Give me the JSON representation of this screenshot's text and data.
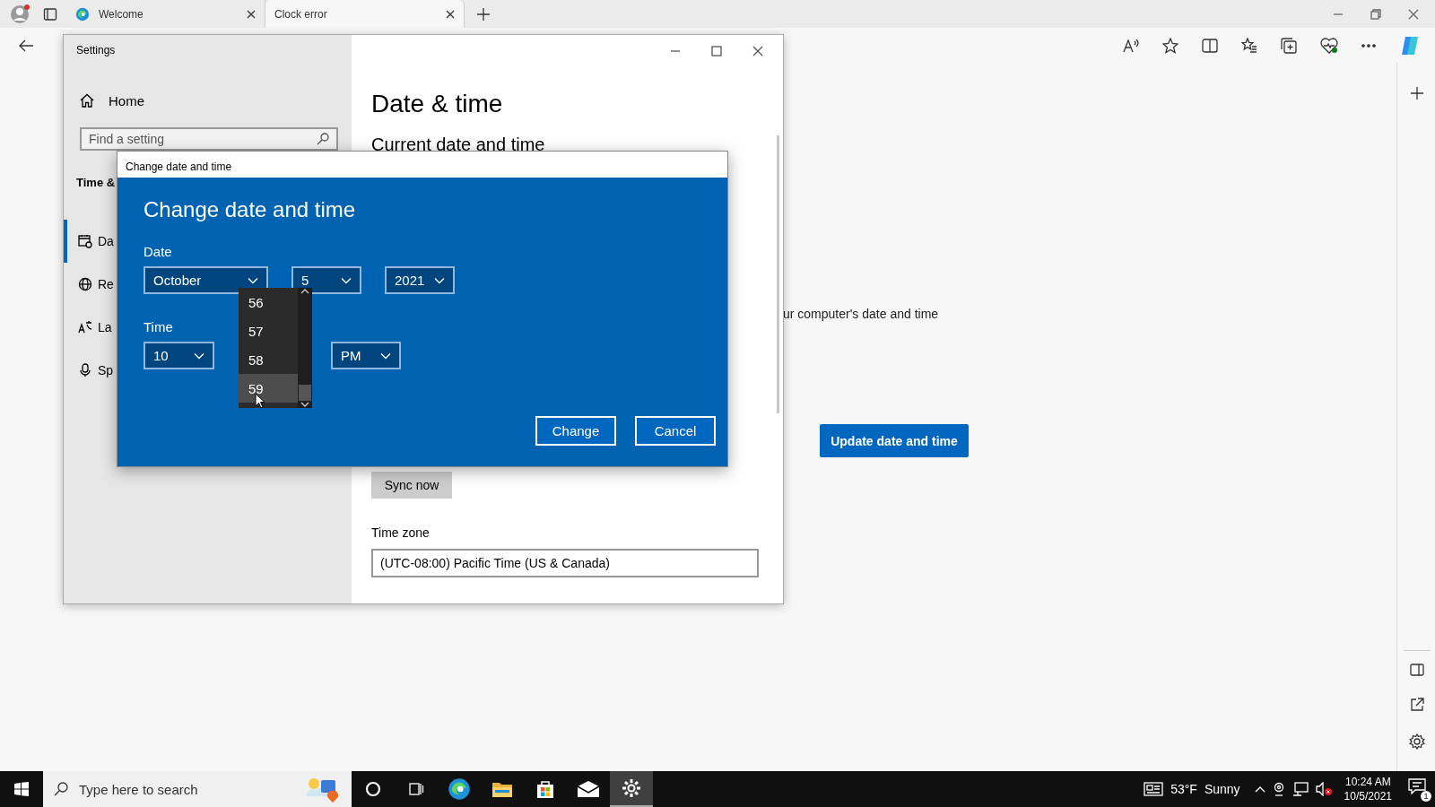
{
  "browser": {
    "tabs": [
      {
        "title": "Welcome",
        "kind": "edge",
        "selected": false
      },
      {
        "title": "Clock error",
        "kind": "page",
        "selected": true
      }
    ]
  },
  "page": {
    "partial_text": "ur computer's date and time",
    "update_button": "Update date and time"
  },
  "settings": {
    "title": "Settings",
    "home": "Home",
    "search_placeholder": "Find a setting",
    "section": "Time &",
    "nav": [
      {
        "label": "Da",
        "kind": "calendar",
        "selected": true
      },
      {
        "label": "Re",
        "kind": "globe",
        "selected": false
      },
      {
        "label": "La",
        "kind": "language",
        "selected": false
      },
      {
        "label": "Sp",
        "kind": "microphone",
        "selected": false
      }
    ],
    "heading": "Date & time",
    "subheading": "Current date and time",
    "sync_button": "Sync now",
    "timezone_label": "Time zone",
    "timezone_value": "(UTC-08:00) Pacific Time (US & Canada)"
  },
  "dialog": {
    "window_title": "Change date and time",
    "heading": "Change date and time",
    "date_label": "Date",
    "month": "October",
    "day": "5",
    "year": "2021",
    "time_label": "Time",
    "hour": "10",
    "ampm": "PM",
    "minutes": [
      {
        "label": "56",
        "selected": false
      },
      {
        "label": "57",
        "selected": false
      },
      {
        "label": "58",
        "selected": false
      },
      {
        "label": "59",
        "selected": true
      }
    ],
    "buttons": [
      "Change",
      "Cancel"
    ]
  },
  "taskbar": {
    "search_placeholder": "Type here to search",
    "apps": [
      {
        "kind": "cortana",
        "active": false
      },
      {
        "kind": "task-view",
        "active": false
      },
      {
        "kind": "edge",
        "active": false
      },
      {
        "kind": "folder",
        "active": false
      },
      {
        "kind": "store",
        "active": false
      },
      {
        "kind": "mail",
        "active": false
      },
      {
        "kind": "gear",
        "active": true
      }
    ],
    "temperature": "53°F",
    "weather": "Sunny",
    "time": "10:24 AM",
    "date": "10/5/2021",
    "notifications": "1"
  }
}
